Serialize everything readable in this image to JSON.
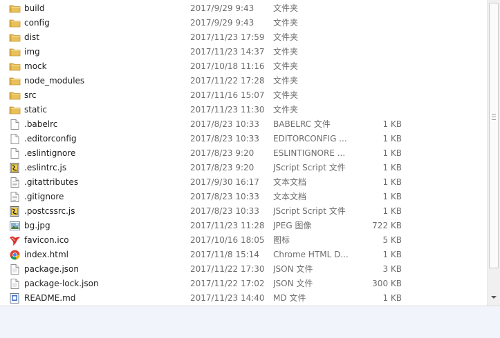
{
  "files": [
    {
      "name": "build",
      "date": "2017/9/29 9:43",
      "type": "文件夹",
      "size": "",
      "icon": "folder-icon"
    },
    {
      "name": "config",
      "date": "2017/9/29 9:43",
      "type": "文件夹",
      "size": "",
      "icon": "folder-icon"
    },
    {
      "name": "dist",
      "date": "2017/11/23 17:59",
      "type": "文件夹",
      "size": "",
      "icon": "folder-icon"
    },
    {
      "name": "img",
      "date": "2017/11/23 14:37",
      "type": "文件夹",
      "size": "",
      "icon": "folder-icon"
    },
    {
      "name": "mock",
      "date": "2017/10/18 11:16",
      "type": "文件夹",
      "size": "",
      "icon": "folder-icon"
    },
    {
      "name": "node_modules",
      "date": "2017/11/22 17:28",
      "type": "文件夹",
      "size": "",
      "icon": "folder-icon"
    },
    {
      "name": "src",
      "date": "2017/11/16 15:07",
      "type": "文件夹",
      "size": "",
      "icon": "folder-icon"
    },
    {
      "name": "static",
      "date": "2017/11/23 11:30",
      "type": "文件夹",
      "size": "",
      "icon": "folder-icon"
    },
    {
      "name": ".babelrc",
      "date": "2017/8/23 10:33",
      "type": "BABELRC 文件",
      "size": "1 KB",
      "icon": "blank-file-icon"
    },
    {
      "name": ".editorconfig",
      "date": "2017/8/23 10:33",
      "type": "EDITORCONFIG ...",
      "size": "1 KB",
      "icon": "blank-file-icon"
    },
    {
      "name": ".eslintignore",
      "date": "2017/8/23 9:20",
      "type": "ESLINTIGNORE ...",
      "size": "1 KB",
      "icon": "blank-file-icon"
    },
    {
      "name": ".eslintrc.js",
      "date": "2017/8/23 9:20",
      "type": "JScript Script 文件",
      "size": "1 KB",
      "icon": "jscript-file-icon"
    },
    {
      "name": ".gitattributes",
      "date": "2017/9/30 16:17",
      "type": "文本文档",
      "size": "1 KB",
      "icon": "text-file-icon"
    },
    {
      "name": ".gitignore",
      "date": "2017/8/23 10:33",
      "type": "文本文档",
      "size": "1 KB",
      "icon": "text-file-icon"
    },
    {
      "name": ".postcssrc.js",
      "date": "2017/8/23 10:33",
      "type": "JScript Script 文件",
      "size": "1 KB",
      "icon": "jscript-file-icon"
    },
    {
      "name": "bg.jpg",
      "date": "2017/11/23 11:28",
      "type": "JPEG 图像",
      "size": "722 KB",
      "icon": "image-file-icon"
    },
    {
      "name": "favicon.ico",
      "date": "2017/10/16 18:05",
      "type": "图标",
      "size": "5 KB",
      "icon": "favicon-icon"
    },
    {
      "name": "index.html",
      "date": "2017/11/8 15:14",
      "type": "Chrome HTML D...",
      "size": "1 KB",
      "icon": "chrome-html-icon"
    },
    {
      "name": "package.json",
      "date": "2017/11/22 17:30",
      "type": "JSON 文件",
      "size": "3 KB",
      "icon": "json-file-icon"
    },
    {
      "name": "package-lock.json",
      "date": "2017/11/22 17:02",
      "type": "JSON 文件",
      "size": "300 KB",
      "icon": "json-file-icon"
    },
    {
      "name": "README.md",
      "date": "2017/11/23 14:40",
      "type": "MD 文件",
      "size": "1 KB",
      "icon": "md-file-icon"
    }
  ],
  "colors": {
    "folder": "#e8c15a",
    "folder_dark": "#c9962e",
    "chrome_red": "#db4437",
    "chrome_yellow": "#f4b400",
    "chrome_green": "#0f9d58",
    "chrome_blue": "#4285f4",
    "favicon_red": "#d9332b",
    "md_blue": "#3a6cc4"
  }
}
